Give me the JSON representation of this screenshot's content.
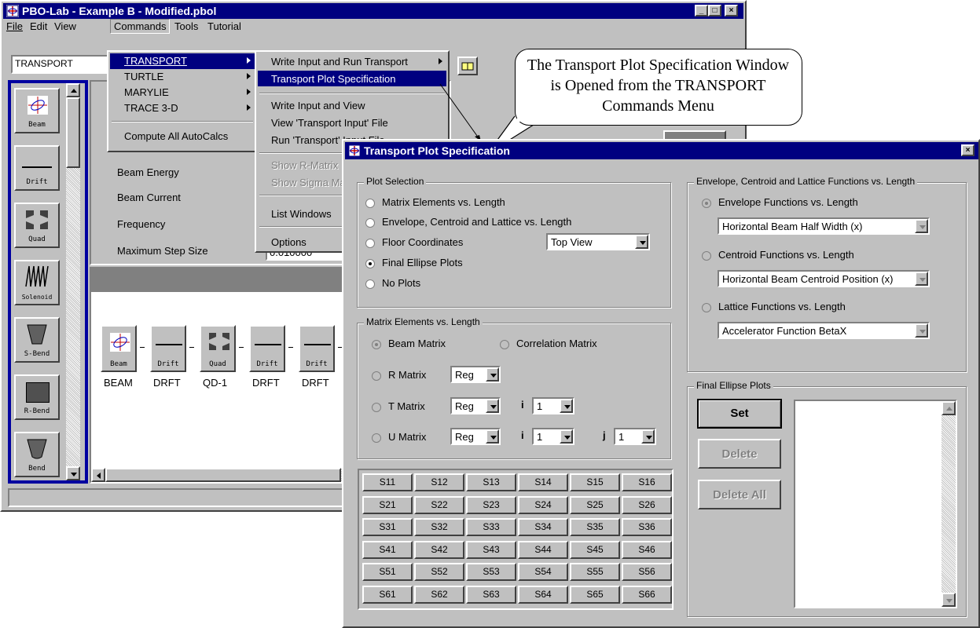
{
  "main_window": {
    "title": "PBO-Lab - Example B - Modified.pbol",
    "menubar": [
      "File",
      "Edit",
      "View",
      "Commands",
      "Tools",
      "Tutorial"
    ],
    "code_combo": "TRANSPORT",
    "toolbox": [
      "Beam",
      "Drift",
      "Quad",
      "Solenoid",
      "S-Bend",
      "R-Bend",
      "Bend"
    ],
    "params": [
      "Beam Energy",
      "Beam Current",
      "Frequency",
      "Maximum Step Size"
    ],
    "step_value": "0.010000",
    "beamline": [
      {
        "icon": "Beam",
        "name": "BEAM"
      },
      {
        "icon": "Drift",
        "name": "DRFT"
      },
      {
        "icon": "Quad",
        "name": "QD-1"
      },
      {
        "icon": "Drift",
        "name": "DRFT"
      },
      {
        "icon": "Drift",
        "name": "DRFT"
      }
    ]
  },
  "commands_menu": {
    "items": [
      "TRANSPORT",
      "TURTLE",
      "MARYLIE",
      "TRACE 3-D",
      "Compute All AutoCalcs"
    ]
  },
  "transport_submenu": {
    "items": [
      {
        "label": "Write Input and Run Transport",
        "enabled": true
      },
      {
        "label": "Transport Plot Specification",
        "enabled": true
      },
      {
        "label": "Write Input and View",
        "enabled": true
      },
      {
        "label": "View 'Transport Input' File",
        "enabled": true
      },
      {
        "label": "Run 'Transport' Input File",
        "enabled": true
      },
      {
        "label": "Show R-Matrix",
        "enabled": false
      },
      {
        "label": "Show Sigma Matrix",
        "enabled": false
      },
      {
        "label": "List Windows",
        "enabled": true
      },
      {
        "label": "Options",
        "enabled": true
      }
    ]
  },
  "callout": "The Transport Plot Specification Window is Opened from the TRANSPORT Commands Menu",
  "dialog": {
    "title": "Transport Plot Specification",
    "plot_selection": {
      "label": "Plot Selection",
      "options": [
        "Matrix Elements vs. Length",
        "Envelope, Centroid and Lattice vs. Length",
        "Floor Coordinates",
        "Final Ellipse Plots",
        "No Plots"
      ],
      "selected": "Final Ellipse Plots",
      "floor_view": "Top View"
    },
    "matrix_elements": {
      "label": "Matrix Elements vs. Length",
      "beam_matrix": "Beam Matrix",
      "correlation_matrix": "Correlation Matrix",
      "r_matrix": "R Matrix",
      "t_matrix": "T Matrix",
      "u_matrix": "U Matrix",
      "reg": "Reg",
      "i_label": "i",
      "j_label": "j",
      "i_value": "1",
      "j_value": "1"
    },
    "grid": [
      [
        "S11",
        "S12",
        "S13",
        "S14",
        "S15",
        "S16"
      ],
      [
        "S21",
        "S22",
        "S23",
        "S24",
        "S25",
        "S26"
      ],
      [
        "S31",
        "S32",
        "S33",
        "S34",
        "S35",
        "S36"
      ],
      [
        "S41",
        "S42",
        "S43",
        "S44",
        "S45",
        "S46"
      ],
      [
        "S51",
        "S52",
        "S53",
        "S54",
        "S55",
        "S56"
      ],
      [
        "S61",
        "S62",
        "S63",
        "S64",
        "S65",
        "S66"
      ]
    ],
    "envelope_group": {
      "label": "Envelope, Centroid and Lattice Functions vs. Length",
      "envelope": "Envelope Functions vs. Length",
      "envelope_value": "Horizontal Beam Half Width (x)",
      "centroid": "Centroid Functions vs. Length",
      "centroid_value": "Horizontal Beam Centroid Position (x)",
      "lattice": "Lattice Functions vs. Length",
      "lattice_value": "Accelerator Function BetaX"
    },
    "final_ellipse": {
      "label": "Final Ellipse Plots",
      "set": "Set",
      "delete": "Delete",
      "delete_all": "Delete All"
    }
  }
}
